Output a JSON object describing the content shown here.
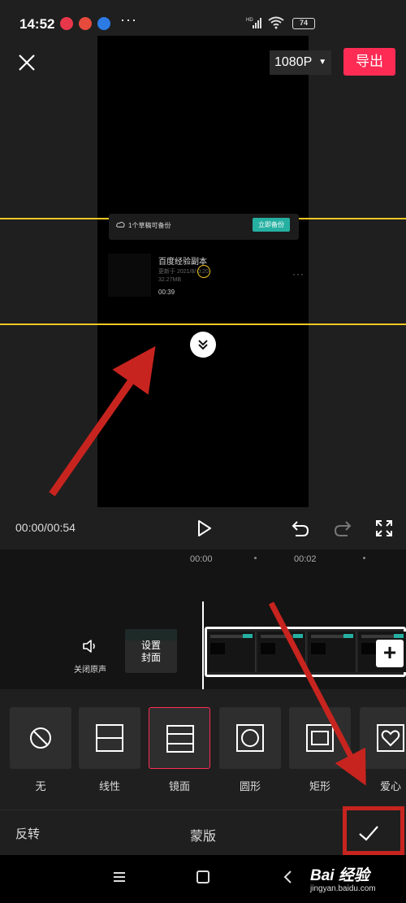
{
  "status_bar": {
    "time": "14:52",
    "signal_label": "HD",
    "battery": "74",
    "more": "···"
  },
  "top_bar": {
    "resolution": "1080P",
    "export_label": "导出"
  },
  "preview_content": {
    "backup_note": "1个草稿可备份",
    "backup_button": "立即备份",
    "draft_title": "百度经验副本",
    "draft_updated": "更新于 2021/8/  0:20",
    "draft_size": "32.27MB",
    "draft_duration": "00:39",
    "more": "···"
  },
  "controls": {
    "timecode": "00:00/00:54"
  },
  "timeline": {
    "ticks": [
      "00:00",
      "00:02"
    ],
    "mute_label": "关闭原声",
    "cover_label_1": "设置",
    "cover_label_2": "封面",
    "add_label": "+"
  },
  "mask_options": [
    {
      "label": "无",
      "icon": "no-mask-icon",
      "selected": false
    },
    {
      "label": "线性",
      "icon": "linear-mask-icon",
      "selected": false
    },
    {
      "label": "镜面",
      "icon": "mirror-mask-icon",
      "selected": true
    },
    {
      "label": "圆形",
      "icon": "circle-mask-icon",
      "selected": false
    },
    {
      "label": "矩形",
      "icon": "rectangle-mask-icon",
      "selected": false
    },
    {
      "label": "爱心",
      "icon": "heart-mask-icon",
      "selected": false
    }
  ],
  "bottom_bar": {
    "invert_label": "反转",
    "title": "蒙版"
  },
  "watermark": {
    "brand": "Bai 经验",
    "url": "jingyan.baidu.com"
  },
  "colors": {
    "accent": "#fe2c55",
    "mask_line": "#f6c823",
    "annotation": "#c8241f",
    "backup": "#25b0a2"
  }
}
